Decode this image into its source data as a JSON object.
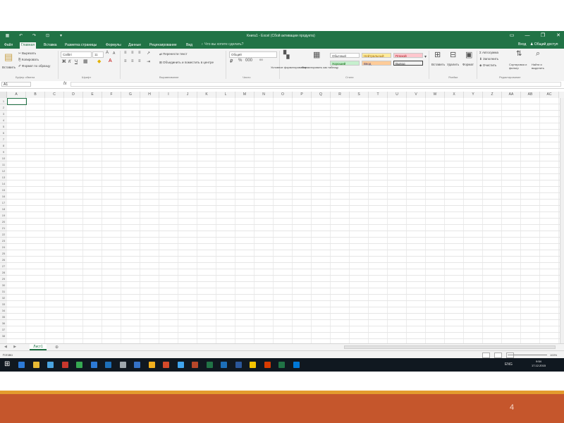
{
  "app": {
    "title": "Книга1 - Excel (Сбой активации продукта)",
    "window_controls": [
      "▭",
      "—",
      "❐",
      "✕"
    ],
    "quick_access": [
      "▦",
      "↶",
      "↷",
      "⊡",
      "▾"
    ]
  },
  "tabs": {
    "items": [
      "Файл",
      "Главная",
      "Вставка",
      "Разметка страницы",
      "Формулы",
      "Данные",
      "Рецензирование",
      "Вид"
    ],
    "active_index": 1,
    "tell_me": "♀ Что вы хотите сделать?",
    "login": "Вход",
    "share": "♟ Общий доступ"
  },
  "ribbon": {
    "clipboard": {
      "paste": "Вставить",
      "cut": "✂ Вырезать",
      "copy": "⎘ Копировать",
      "format_painter": "✐ Формат по образцу",
      "label": "Буфер обмена"
    },
    "font": {
      "name": "Calibri",
      "size": "11",
      "bold": "Ж",
      "italic": "К",
      "underline": "Ч",
      "label": "Шрифт"
    },
    "alignment": {
      "wrap": "⇌ Перенести текст",
      "merge": "⊞ Объединить и поместить в центре",
      "label": "Выравнивание"
    },
    "number": {
      "format": "Общий",
      "label": "Число"
    },
    "styles": {
      "conditional": "Условное форматирование",
      "as_table": "Форматировать как таблицу",
      "cells": [
        "Обычный",
        "Нейтральный",
        "Плохой",
        "Хороший",
        "Ввод",
        "Вывод"
      ],
      "label": "Стили"
    },
    "cells": {
      "insert": "Вставить",
      "delete": "Удалить",
      "format": "Формат",
      "label": "Ячейки"
    },
    "editing": {
      "autosum": "Σ Автосумма",
      "fill": "⬇ Заполнить",
      "clear": "◈ Очистить",
      "sort": "Сортировка и фильтр",
      "find": "Найти и выделить",
      "label": "Редактирование"
    }
  },
  "formula_bar": {
    "name_box": "A1",
    "fx": "fx"
  },
  "grid": {
    "columns": [
      "A",
      "B",
      "C",
      "D",
      "E",
      "F",
      "G",
      "H",
      "I",
      "J",
      "K",
      "L",
      "M",
      "N",
      "O",
      "P",
      "Q",
      "R",
      "S",
      "T",
      "U",
      "V",
      "W",
      "X",
      "Y",
      "Z",
      "AA",
      "AB",
      "AC"
    ],
    "rows": [
      "1",
      "2",
      "3",
      "4",
      "5",
      "6",
      "7",
      "8",
      "9",
      "10",
      "11",
      "12",
      "13",
      "14",
      "15",
      "16",
      "17",
      "18",
      "19",
      "20",
      "21",
      "22",
      "23",
      "24",
      "25",
      "26",
      "27",
      "28",
      "29",
      "30",
      "31",
      "32",
      "33",
      "34",
      "35",
      "36",
      "37",
      "38"
    ]
  },
  "sheets": {
    "tabs": [
      "Лист1"
    ],
    "add": "⊕",
    "nav": "◀ ▶"
  },
  "status": {
    "ready": "Готово",
    "zoom": "100%"
  },
  "taskbar": {
    "start": "⊞",
    "lang": "ENG",
    "time": "9:54",
    "date": "17.12.2015",
    "icon_colors": [
      "#2d7ad6",
      "#e7b934",
      "#4aa3df",
      "#c8372d",
      "#36a852",
      "#2d7ad6",
      "#1d6fb8",
      "#9ea7ad",
      "#3572c6",
      "#f2b01e",
      "#d44a2a",
      "#41a5ee",
      "#b7472a",
      "#217346",
      "#1d6fb8",
      "#2b579a",
      "#f5c400",
      "#d83b01",
      "#217346",
      "#0078d7"
    ]
  },
  "slide": {
    "page_number": "4"
  }
}
